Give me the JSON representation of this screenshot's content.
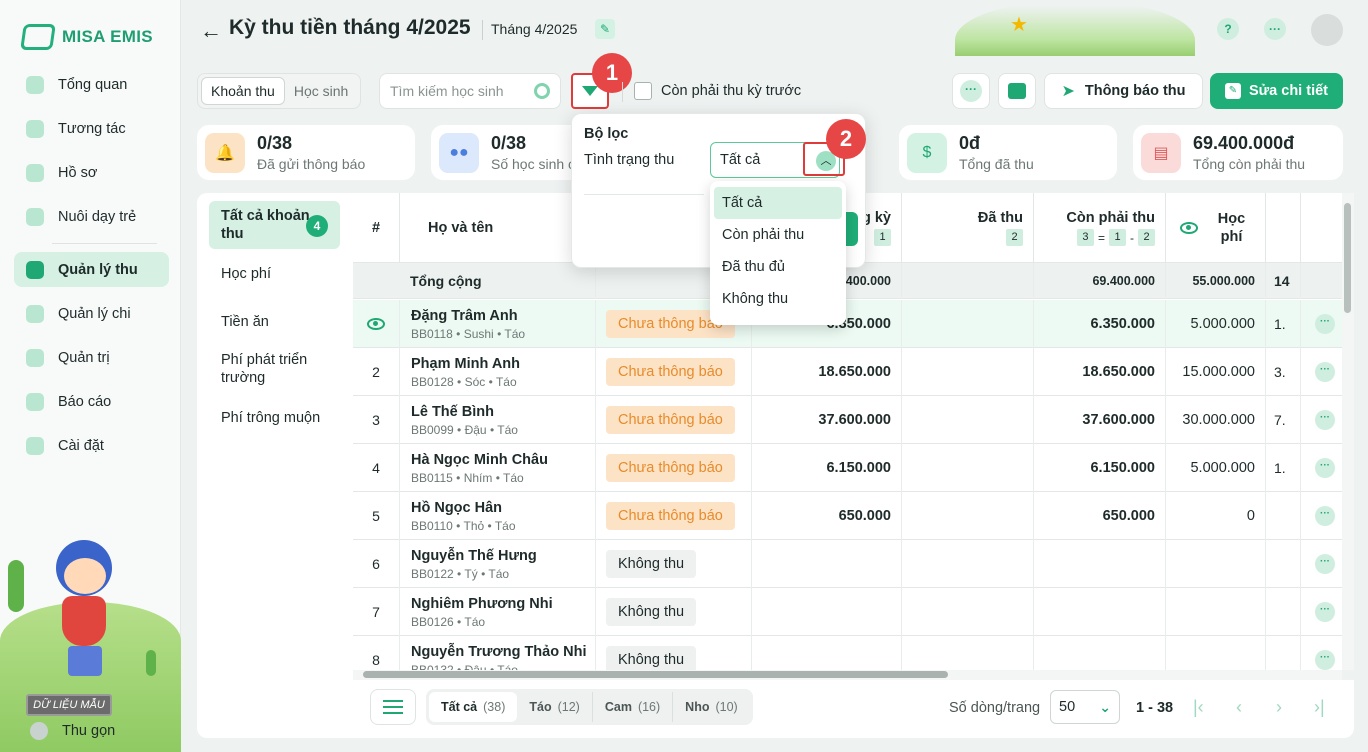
{
  "app": {
    "logo_text": "MISA EMIS"
  },
  "sidebar": {
    "items": [
      {
        "label": "Tổng quan"
      },
      {
        "label": "Tương tác"
      },
      {
        "label": "Hồ sơ"
      },
      {
        "label": "Nuôi dạy trẻ"
      },
      {
        "label": "Quản lý thu",
        "active": true
      },
      {
        "label": "Quản lý chi"
      },
      {
        "label": "Quản trị"
      },
      {
        "label": "Báo cáo"
      },
      {
        "label": "Cài đặt"
      }
    ],
    "badge": "DỮ LIỆU MẪU",
    "collapse_label": "Thu gọn"
  },
  "header": {
    "back_icon": "arrow-left-icon",
    "title": "Kỳ thu tiền tháng 4/2025",
    "month_label": "Tháng 4/2025",
    "help_icon": "?",
    "more_icon": "···"
  },
  "toolbar": {
    "seg_fee": "Khoản thu",
    "seg_student": "Học sinh",
    "search_placeholder": "Tìm kiếm học sinh",
    "checkbox_label": "Còn phải thu kỳ trước",
    "notify_label": "Thông báo thu",
    "edit_label": "Sửa chi tiết",
    "more_icon": "···"
  },
  "markers": {
    "m1": "1",
    "m2": "2"
  },
  "stats": [
    {
      "value": "0/38",
      "label": "Đã gửi thông báo",
      "icon": "bell-icon",
      "color": "#fde3c6"
    },
    {
      "value": "0/38",
      "label": "Số học sinh c",
      "icon": "people-icon",
      "color": "#dce8fb"
    },
    {
      "value": "0đ",
      "label": "Tổng đã thu",
      "icon": "money-bag-icon",
      "color": "#d3f2e3"
    },
    {
      "value": "69.400.000đ",
      "label": "Tổng còn phải thu",
      "icon": "wallet-icon",
      "color": "#fbdada"
    }
  ],
  "fee_types": {
    "all_label": "Tất cả khoản thu",
    "all_count": "4",
    "items": [
      "Học phí",
      "Tiền ăn",
      "Phí phát triển trường",
      "Phí trông muộn"
    ]
  },
  "table": {
    "headers": {
      "no": "#",
      "name": "Họ và tên",
      "period": "g kỳ",
      "period_num": "1",
      "paid": "Đã thu",
      "paid_num": "2",
      "remaining": "Còn phải thu",
      "rem_a": "3",
      "rem_eq": "=",
      "rem_b": "1",
      "rem_minus": "-",
      "rem_c": "2",
      "tuition": "Học phí"
    },
    "total": {
      "label": "Tổng cộng",
      "period": "'.400.000",
      "remaining": "69.400.000",
      "tuition": "55.000.000",
      "extra": "14"
    },
    "rows": [
      {
        "no": "",
        "name": "Đặng Trâm Anh",
        "code": "BB0118",
        "nick": "Sushi",
        "group": "Táo",
        "status": "Chưa thông báo",
        "period": "6.350.000",
        "remaining": "6.350.000",
        "tuition": "5.000.000",
        "extra": "1."
      },
      {
        "no": "2",
        "name": "Phạm Minh Anh",
        "code": "BB0128",
        "nick": "Sóc",
        "group": "Táo",
        "status": "Chưa thông báo",
        "period": "18.650.000",
        "remaining": "18.650.000",
        "tuition": "15.000.000",
        "extra": "3."
      },
      {
        "no": "3",
        "name": "Lê Thế Bình",
        "code": "BB0099",
        "nick": "Đậu",
        "group": "Táo",
        "status": "Chưa thông báo",
        "period": "37.600.000",
        "remaining": "37.600.000",
        "tuition": "30.000.000",
        "extra": "7."
      },
      {
        "no": "4",
        "name": "Hà Ngọc Minh Châu",
        "code": "BB0115",
        "nick": "Nhím",
        "group": "Táo",
        "status": "Chưa thông báo",
        "period": "6.150.000",
        "remaining": "6.150.000",
        "tuition": "5.000.000",
        "extra": "1."
      },
      {
        "no": "5",
        "name": "Hồ Ngọc Hân",
        "code": "BB0110",
        "nick": "Thỏ",
        "group": "Táo",
        "status": "Chưa thông báo",
        "period": "650.000",
        "remaining": "650.000",
        "tuition": "0",
        "extra": ""
      },
      {
        "no": "6",
        "name": "Nguyễn Thế Hưng",
        "code": "BB0122",
        "nick": "Tý",
        "group": "Táo",
        "status": "Không thu",
        "period": "",
        "remaining": "",
        "tuition": "",
        "extra": ""
      },
      {
        "no": "7",
        "name": "Nghiêm Phương Nhi",
        "code": "BB0126",
        "nick": "",
        "group": "Táo",
        "status": "Không thu",
        "period": "",
        "remaining": "",
        "tuition": "",
        "extra": ""
      },
      {
        "no": "8",
        "name": "Nguyễn Trương Thảo Nhi",
        "code": "BB0132",
        "nick": "Đậu",
        "group": "Táo",
        "status": "Không thu",
        "period": "",
        "remaining": "",
        "tuition": "",
        "extra": ""
      }
    ]
  },
  "footer": {
    "tabs": [
      {
        "label": "Tất cả",
        "count": "(38)"
      },
      {
        "label": "Táo",
        "count": "(12)"
      },
      {
        "label": "Cam",
        "count": "(16)"
      },
      {
        "label": "Nho",
        "count": "(10)"
      }
    ],
    "rows_label": "Số dòng/trang",
    "rows_value": "50",
    "range": "1 - 38"
  },
  "filter_popup": {
    "title": "Bộ lọc",
    "label": "Tình trạng thu",
    "selected": "Tất cả",
    "options": [
      "Tất cả",
      "Còn phải thu",
      "Đã thu đủ",
      "Không thu"
    ]
  }
}
